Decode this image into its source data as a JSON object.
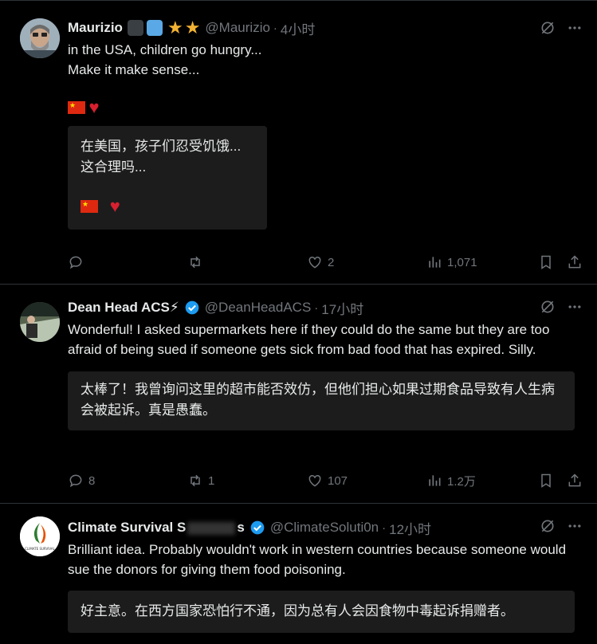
{
  "tweets": [
    {
      "name": "Maurizio",
      "handle": "@Maurizio",
      "time": "4小时",
      "text": "in the USA, children go hungry...\nMake it make sense...",
      "translation": "在美国，孩子们忍受饥饿...\n这合理吗...",
      "replies": "",
      "retweets": "",
      "likes": "2",
      "views": "1,071"
    },
    {
      "name": "Dean Head ACS⚡",
      "handle": "@DeanHeadACS",
      "time": "17小时",
      "text": "Wonderful! I asked supermarkets here if they could do the same but they are too afraid of being sued if someone gets sick from bad food that has expired. Silly.",
      "translation": "太棒了！我曾询问这里的超市能否效仿，但他们担心如果过期食品导致有人生病会被起诉。真是愚蠢。",
      "replies": "8",
      "retweets": "1",
      "likes": "107",
      "views": "1.2万"
    },
    {
      "name_a": "Climate Survival S",
      "name_b": "s",
      "handle": "@ClimateSoluti0n",
      "time": "12小时",
      "text": "Brilliant idea. Probably wouldn't work in western countries because someone would sue the donors for giving them food poisoning.",
      "translation": "好主意。在西方国家恐怕行不通，因为总有人会因食物中毒起诉捐赠者。",
      "avatar_caption": "CLIMATE SURVIVAL"
    }
  ],
  "sep": "·",
  "colors": {
    "accent": "#1d9bf0",
    "muted": "#71767b",
    "star": "#f2b233",
    "heart": "#d8202f"
  },
  "icons": [
    "grok-icon",
    "more-icon",
    "reply-icon",
    "retweet-icon",
    "like-icon",
    "views-icon",
    "bookmark-icon",
    "share-icon",
    "verified-icon"
  ]
}
